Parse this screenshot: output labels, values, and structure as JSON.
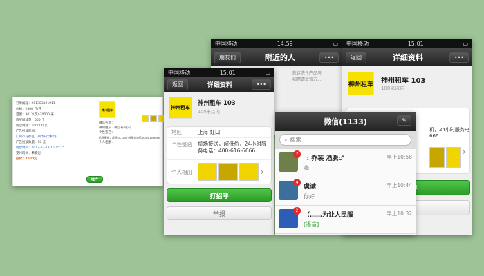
{
  "order_page": {
    "rows": [
      "订单编号：201303121911",
      "价格：2500 元/月",
      "范围：3012(次)-30000 米",
      "购买阅读量：500 个",
      "阅读时效：100000 次",
      "广告投放时间：",
      "广州市花都区广州市白云机场",
      "广告投放数量：10 元",
      "创建时间：2013-03-13 15:15:15",
      "支付时间：未支付"
    ],
    "price": "应付：2500元",
    "promote_btn": "推广",
    "mid_col": [
      "微信名称：",
      "神州租车 · 微信号码(4)",
      "个性签名：",
      "机场接送，超低价，24小时服务电话400-616-6666",
      "个人相册："
    ]
  },
  "phone_b": {
    "status": {
      "carrier": "中国移动",
      "time": "14:59"
    },
    "nav": {
      "back": "朋友们",
      "title": "附近的人",
      "more": "•••"
    },
    "row_text": [
      "新这洗性产品与",
      "招聘请士官方..."
    ]
  },
  "phone_c": {
    "status": {
      "carrier": "中国移动",
      "time": "15:01"
    },
    "nav": {
      "back": "返回",
      "title": "详细资料",
      "more": "•••"
    },
    "name": "神州租车 103",
    "distance": "100米以内",
    "sign_partial": "机，24小时服务电",
    "sign_partial2": "666",
    "button": "打招呼"
  },
  "phone_a": {
    "status": {
      "carrier": "中国移动",
      "time": "15:01"
    },
    "nav": {
      "back": "返回",
      "title": "详细资料",
      "more": "•••"
    },
    "name": "神州租车 103",
    "distance": "100米以内",
    "region_label": "地区",
    "region": "上海 虹口",
    "sign_label": "个性签名",
    "sign": "机场接送，超低价，24小时服务电话：400-616-6666",
    "album_label": "个人相册",
    "greet": "打招呼",
    "report": "举报",
    "logo": "神州租车"
  },
  "chat_list": {
    "title": "微信(1133)",
    "search": "搜索",
    "chats": [
      {
        "name": "_: 乔装 酒脱♂",
        "msg": "嗨",
        "time": "早上10:58",
        "badge": "2"
      },
      {
        "name": "虞诚",
        "msg": "你好",
        "time": "早上10:44",
        "badge": "4"
      },
      {
        "name": "（……为让人民服",
        "msg": "[语音]",
        "time": "早上10:32",
        "badge": "2"
      }
    ]
  },
  "colors": {
    "background": "#9ec397",
    "wechat_green": "#2b9c27",
    "logo_yellow": "#f7e100"
  }
}
